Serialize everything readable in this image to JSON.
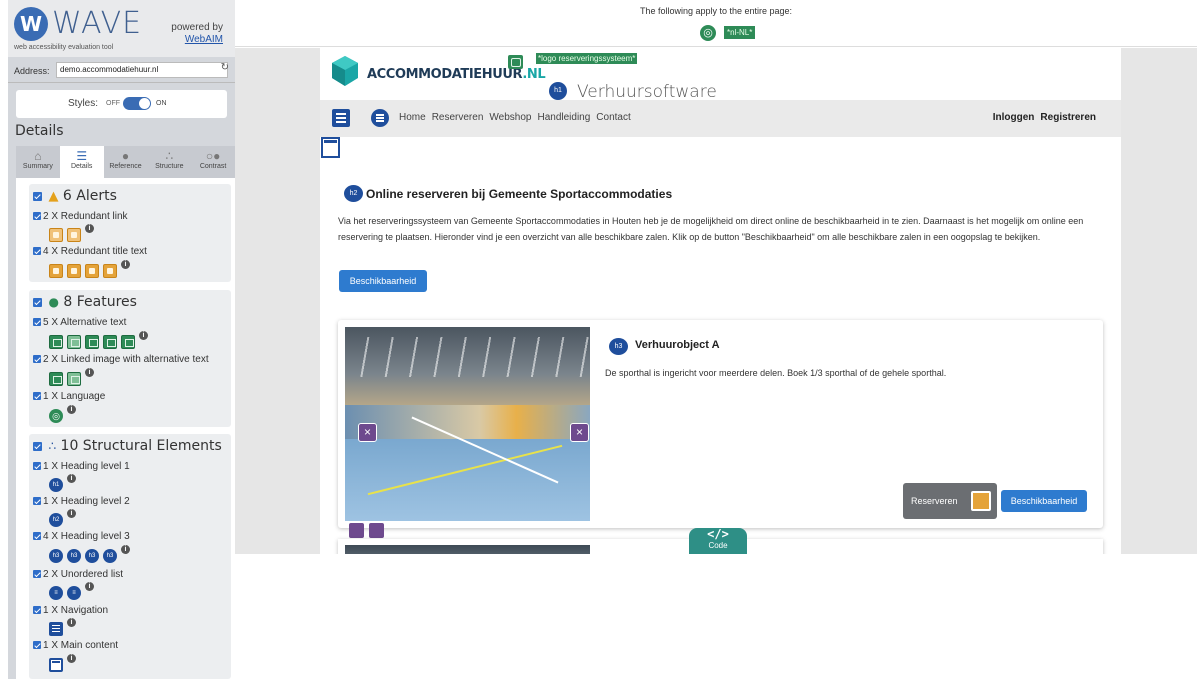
{
  "wave": {
    "brand": "WAVE",
    "tagline": "web accessibility evaluation tool",
    "powered_by": "powered by",
    "webaim": "WebAIM",
    "address_label": "Address:",
    "address_value": "demo.accommodatiehuur.nl",
    "styles_label": "Styles:",
    "styles_off": "OFF",
    "styles_on": "ON",
    "details_title": "Details",
    "tabs": [
      {
        "label": "Summary",
        "icon": "home-icon"
      },
      {
        "label": "Details",
        "icon": "list-icon"
      },
      {
        "label": "Reference",
        "icon": "info-icon"
      },
      {
        "label": "Structure",
        "icon": "structure-icon"
      },
      {
        "label": "Contrast",
        "icon": "contrast-icon"
      }
    ],
    "alerts": {
      "title": "6 Alerts",
      "items": [
        {
          "label": "2 X Redundant link",
          "count": 2
        },
        {
          "label": "4 X Redundant title text",
          "count": 4
        }
      ]
    },
    "features": {
      "title": "8 Features",
      "items": [
        {
          "label": "5 X Alternative text",
          "count": 5
        },
        {
          "label": "2 X Linked image with alternative text",
          "count": 2
        },
        {
          "label": "1 X Language",
          "count": 1
        }
      ]
    },
    "structure": {
      "title": "10 Structural Elements",
      "items": [
        {
          "label": "1 X Heading level 1",
          "badge": "h1"
        },
        {
          "label": "1 X Heading level 2",
          "badge": "h2"
        },
        {
          "label": "4 X Heading level 3",
          "badge": "h3"
        },
        {
          "label": "2 X Unordered list"
        },
        {
          "label": "1 X Navigation"
        },
        {
          "label": "1 X Main content"
        }
      ]
    }
  },
  "topbar": {
    "message": "The following apply to the entire page:",
    "lang_tag": "*nl-NL*"
  },
  "site": {
    "logo_main": "ACCOMMODATIEHUUR",
    "logo_nl": ".NL",
    "alt_tag": "*logo reserveringssysteem*",
    "h1_badge": "h1",
    "h1": "Verhuursoftware",
    "nav_links": [
      "Home",
      "Reserveren",
      "Webshop",
      "Handleiding",
      "Contact"
    ],
    "nav_login": "Inloggen",
    "nav_register": "Registreren",
    "h2_badge": "h2",
    "h2": "Online reserveren bij Gemeente Sportaccommodaties",
    "intro": "Via het reserveringssysteem van Gemeente Sportaccommodaties in Houten heb je de mogelijkheid om direct online de beschikbaarheid in te zien. Daarnaast is het mogelijk om online een reservering te plaatsen. Hieronder vind je een overzicht van alle beschikbare zalen. Klik op de button \"Beschikbaarheid\" om alle beschikbare zalen in een oogopslag te bekijken.",
    "btn_beschikbaarheid": "Beschikbaarheid",
    "card": {
      "h3_badge": "h3",
      "title": "Verhuurobject A",
      "desc": "De sporthal is ingericht voor meerdere delen. Boek 1/3 sporthal of de gehele sporthal.",
      "btn_reserveren": "Reserveren",
      "btn_beschikbaarheid": "Beschikbaarheid"
    },
    "code_label": "Code",
    "code_brackets": "</>"
  }
}
